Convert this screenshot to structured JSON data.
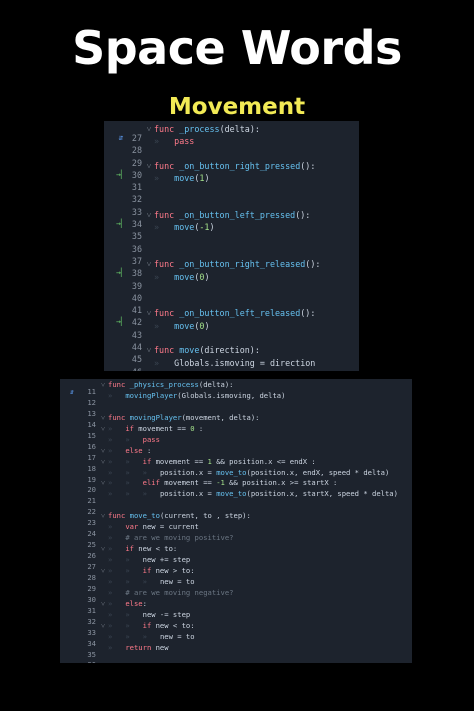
{
  "title": "Space Words",
  "subtitle": "Movement",
  "colors": {
    "page_bg": "#000000",
    "title": "#ffffff",
    "subtitle": "#f2ea55",
    "editor_bg": "#1d232d",
    "keyword": "#ff7a8a",
    "function": "#66c1f0",
    "number": "#a3e08a",
    "comment": "#6b7683",
    "line_number": "#8a93a0"
  },
  "panels": [
    {
      "lines": [
        {
          "n": "27",
          "mark": "override",
          "fold": true,
          "ind": 0,
          "tokens": [
            [
              "kw",
              "func "
            ],
            [
              "fn",
              "_process"
            ],
            [
              "txt",
              "(delta):"
            ]
          ]
        },
        {
          "n": "28",
          "mark": "",
          "fold": false,
          "ind": 1,
          "tokens": [
            [
              "kw",
              "pass"
            ]
          ]
        },
        {
          "n": "29",
          "mark": "",
          "fold": false,
          "ind": 0,
          "tokens": []
        },
        {
          "n": "30",
          "mark": "signal",
          "fold": true,
          "ind": 0,
          "tokens": [
            [
              "kw",
              "func "
            ],
            [
              "fn",
              "_on_button_right_pressed"
            ],
            [
              "txt",
              "():"
            ]
          ]
        },
        {
          "n": "31",
          "mark": "",
          "fold": false,
          "ind": 1,
          "tokens": [
            [
              "fn",
              "move"
            ],
            [
              "txt",
              "("
            ],
            [
              "num-lit",
              "1"
            ],
            [
              "txt",
              ")"
            ]
          ]
        },
        {
          "n": "32",
          "mark": "",
          "fold": false,
          "ind": 0,
          "tokens": []
        },
        {
          "n": "33",
          "mark": "",
          "fold": false,
          "ind": 0,
          "tokens": []
        },
        {
          "n": "34",
          "mark": "signal",
          "fold": true,
          "ind": 0,
          "tokens": [
            [
              "kw",
              "func "
            ],
            [
              "fn",
              "_on_button_left_pressed"
            ],
            [
              "txt",
              "():"
            ]
          ]
        },
        {
          "n": "35",
          "mark": "",
          "fold": false,
          "ind": 1,
          "tokens": [
            [
              "fn",
              "move"
            ],
            [
              "txt",
              "("
            ],
            [
              "num-lit",
              "-1"
            ],
            [
              "txt",
              ")"
            ]
          ]
        },
        {
          "n": "36",
          "mark": "",
          "fold": false,
          "ind": 0,
          "tokens": []
        },
        {
          "n": "37",
          "mark": "",
          "fold": false,
          "ind": 0,
          "tokens": []
        },
        {
          "n": "38",
          "mark": "signal",
          "fold": true,
          "ind": 0,
          "tokens": [
            [
              "kw",
              "func "
            ],
            [
              "fn",
              "_on_button_right_released"
            ],
            [
              "txt",
              "():"
            ]
          ]
        },
        {
          "n": "39",
          "mark": "",
          "fold": false,
          "ind": 1,
          "tokens": [
            [
              "fn",
              "move"
            ],
            [
              "txt",
              "("
            ],
            [
              "num-lit",
              "0"
            ],
            [
              "txt",
              ")"
            ]
          ]
        },
        {
          "n": "40",
          "mark": "",
          "fold": false,
          "ind": 0,
          "tokens": []
        },
        {
          "n": "41",
          "mark": "",
          "fold": false,
          "ind": 0,
          "tokens": []
        },
        {
          "n": "42",
          "mark": "signal",
          "fold": true,
          "ind": 0,
          "tokens": [
            [
              "kw",
              "func "
            ],
            [
              "fn",
              "_on_button_left_released"
            ],
            [
              "txt",
              "():"
            ]
          ]
        },
        {
          "n": "43",
          "mark": "",
          "fold": false,
          "ind": 1,
          "tokens": [
            [
              "fn",
              "move"
            ],
            [
              "txt",
              "("
            ],
            [
              "num-lit",
              "0"
            ],
            [
              "txt",
              ")"
            ]
          ]
        },
        {
          "n": "44",
          "mark": "",
          "fold": false,
          "ind": 0,
          "tokens": []
        },
        {
          "n": "45",
          "mark": "",
          "fold": true,
          "ind": 0,
          "tokens": [
            [
              "kw",
              "func "
            ],
            [
              "fn",
              "move"
            ],
            [
              "txt",
              "(direction):"
            ]
          ]
        },
        {
          "n": "46",
          "mark": "",
          "fold": false,
          "ind": 1,
          "tokens": [
            [
              "txt",
              "Globals.ismoving = direction"
            ]
          ]
        }
      ]
    },
    {
      "lines": [
        {
          "n": "11",
          "mark": "override",
          "fold": true,
          "ind": 0,
          "tokens": [
            [
              "kw",
              "func "
            ],
            [
              "fn",
              "_physics_process"
            ],
            [
              "txt",
              "(delta):"
            ]
          ]
        },
        {
          "n": "12",
          "mark": "",
          "fold": false,
          "ind": 1,
          "tokens": [
            [
              "fn",
              "movingPlayer"
            ],
            [
              "txt",
              "(Globals.ismoving, delta)"
            ]
          ]
        },
        {
          "n": "13",
          "mark": "",
          "fold": false,
          "ind": 0,
          "tokens": []
        },
        {
          "n": "14",
          "mark": "",
          "fold": true,
          "ind": 0,
          "tokens": [
            [
              "kw",
              "func "
            ],
            [
              "fn",
              "movingPlayer"
            ],
            [
              "txt",
              "(movement, delta):"
            ]
          ]
        },
        {
          "n": "15",
          "mark": "",
          "fold": true,
          "ind": 1,
          "tokens": [
            [
              "kw",
              "if "
            ],
            [
              "txt",
              "movement == "
            ],
            [
              "num-lit",
              "0"
            ],
            [
              "txt",
              " :"
            ]
          ]
        },
        {
          "n": "16",
          "mark": "",
          "fold": false,
          "ind": 2,
          "tokens": [
            [
              "kw",
              "pass"
            ]
          ]
        },
        {
          "n": "17",
          "mark": "",
          "fold": true,
          "ind": 1,
          "tokens": [
            [
              "kw",
              "else"
            ],
            [
              "txt",
              " :"
            ]
          ]
        },
        {
          "n": "18",
          "mark": "",
          "fold": true,
          "ind": 2,
          "tokens": [
            [
              "kw",
              "if "
            ],
            [
              "txt",
              "movement == "
            ],
            [
              "num-lit",
              "1"
            ],
            [
              "txt",
              " && position.x <= endX :"
            ]
          ]
        },
        {
          "n": "19",
          "mark": "",
          "fold": false,
          "ind": 3,
          "tokens": [
            [
              "txt",
              "position.x = "
            ],
            [
              "fn",
              "move_to"
            ],
            [
              "txt",
              "(position.x, endX, speed * delta)"
            ]
          ]
        },
        {
          "n": "20",
          "mark": "",
          "fold": true,
          "ind": 2,
          "tokens": [
            [
              "kw",
              "elif "
            ],
            [
              "txt",
              "movement == "
            ],
            [
              "num-lit",
              "-1"
            ],
            [
              "txt",
              " && position.x >= startX :"
            ]
          ]
        },
        {
          "n": "21",
          "mark": "",
          "fold": false,
          "ind": 3,
          "tokens": [
            [
              "txt",
              "position.x = "
            ],
            [
              "fn",
              "move_to"
            ],
            [
              "txt",
              "(position.x, startX, speed * delta)"
            ]
          ]
        },
        {
          "n": "22",
          "mark": "",
          "fold": false,
          "ind": 0,
          "tokens": []
        },
        {
          "n": "23",
          "mark": "",
          "fold": true,
          "ind": 0,
          "tokens": [
            [
              "kw",
              "func "
            ],
            [
              "fn",
              "move_to"
            ],
            [
              "txt",
              "(current, to , step):"
            ]
          ]
        },
        {
          "n": "24",
          "mark": "",
          "fold": false,
          "ind": 1,
          "tokens": [
            [
              "kw",
              "var "
            ],
            [
              "txt",
              "new = current"
            ]
          ]
        },
        {
          "n": "25",
          "mark": "",
          "fold": false,
          "ind": 1,
          "tokens": [
            [
              "cm",
              "# are we moving positive?"
            ]
          ]
        },
        {
          "n": "26",
          "mark": "",
          "fold": true,
          "ind": 1,
          "tokens": [
            [
              "kw",
              "if "
            ],
            [
              "txt",
              "new < to:"
            ]
          ]
        },
        {
          "n": "27",
          "mark": "",
          "fold": false,
          "ind": 2,
          "tokens": [
            [
              "txt",
              "new += step"
            ]
          ]
        },
        {
          "n": "28",
          "mark": "",
          "fold": true,
          "ind": 2,
          "tokens": [
            [
              "kw",
              "if "
            ],
            [
              "txt",
              "new > to:"
            ]
          ]
        },
        {
          "n": "29",
          "mark": "",
          "fold": false,
          "ind": 3,
          "tokens": [
            [
              "txt",
              "new = to"
            ]
          ]
        },
        {
          "n": "30",
          "mark": "",
          "fold": false,
          "ind": 1,
          "tokens": [
            [
              "cm",
              "# are we moving negative?"
            ]
          ]
        },
        {
          "n": "31",
          "mark": "",
          "fold": true,
          "ind": 1,
          "tokens": [
            [
              "kw",
              "else"
            ],
            [
              "txt",
              ":"
            ]
          ]
        },
        {
          "n": "32",
          "mark": "",
          "fold": false,
          "ind": 2,
          "tokens": [
            [
              "txt",
              "new -= step"
            ]
          ]
        },
        {
          "n": "33",
          "mark": "",
          "fold": true,
          "ind": 2,
          "tokens": [
            [
              "kw",
              "if "
            ],
            [
              "txt",
              "new < to:"
            ]
          ]
        },
        {
          "n": "34",
          "mark": "",
          "fold": false,
          "ind": 3,
          "tokens": [
            [
              "txt",
              "new = to"
            ]
          ]
        },
        {
          "n": "35",
          "mark": "",
          "fold": false,
          "ind": 1,
          "tokens": [
            [
              "kw",
              "return "
            ],
            [
              "txt",
              "new"
            ]
          ]
        },
        {
          "n": "36",
          "mark": "",
          "fold": false,
          "ind": 0,
          "tokens": []
        }
      ]
    }
  ]
}
